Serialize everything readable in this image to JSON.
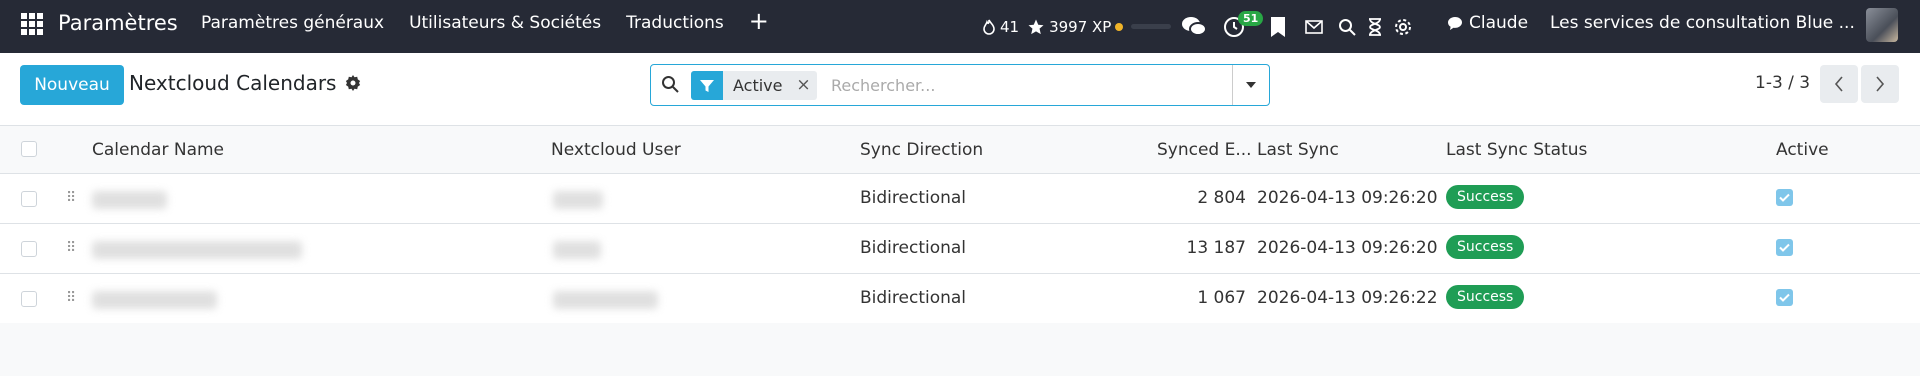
{
  "navbar": {
    "app_name": "Paramètres",
    "menu": [
      "Paramètres généraux",
      "Utilisateurs & Sociétés",
      "Traductions"
    ],
    "add_symbol": "+",
    "streak": "41",
    "xp": "3997 XP",
    "activity_count": "51",
    "user_name": "Claude",
    "company": "Les services de consultation Blue ..."
  },
  "control": {
    "new_label": "Nouveau",
    "title": "Nextcloud Calendars",
    "facet_label": "Active",
    "facet_remove": "×",
    "search_placeholder": "Rechercher...",
    "pager": "1-3 / 3"
  },
  "table": {
    "headers": [
      "Calendar Name",
      "Nextcloud User",
      "Sync Direction",
      "Synced E...",
      "Last Sync",
      "Last Sync Status",
      "Active"
    ],
    "rows": [
      {
        "sync_direction": "Bidirectional",
        "synced": "2 804",
        "last_sync": "2026-04-13 09:26:20",
        "status": "Success",
        "active": true
      },
      {
        "sync_direction": "Bidirectional",
        "synced": "13 187",
        "last_sync": "2026-04-13 09:26:20",
        "status": "Success",
        "active": true
      },
      {
        "sync_direction": "Bidirectional",
        "synced": "1 067",
        "last_sync": "2026-04-13 09:26:22",
        "status": "Success",
        "active": true
      }
    ]
  },
  "colors": {
    "navbar": "#262a36",
    "primary": "#27a7d8",
    "success": "#1f9d55"
  }
}
